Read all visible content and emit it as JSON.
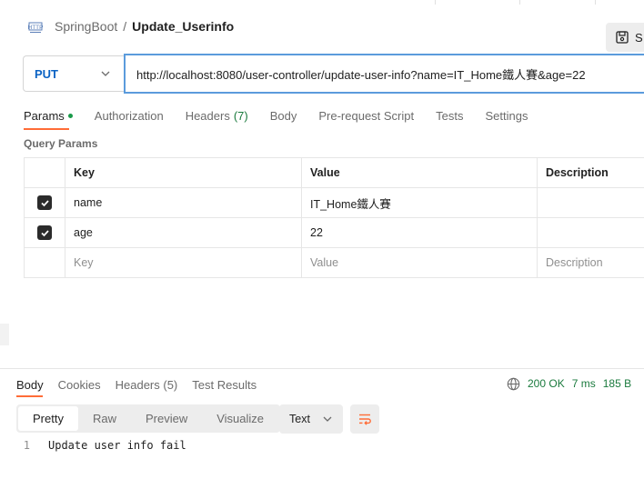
{
  "breadcrumb": {
    "collection": "SpringBoot",
    "separator": "/",
    "request_name": "Update_Userinfo"
  },
  "toolbar": {
    "save_label": "S"
  },
  "request": {
    "method": "PUT",
    "url": "http://localhost:8080/user-controller/update-user-info?name=IT_Home鐵人賽&age=22"
  },
  "request_tabs": [
    {
      "label": "Params",
      "active": true,
      "indicator": "green-dot"
    },
    {
      "label": "Authorization"
    },
    {
      "label": "Headers",
      "count": "(7)"
    },
    {
      "label": "Body"
    },
    {
      "label": "Pre-request Script"
    },
    {
      "label": "Tests"
    },
    {
      "label": "Settings"
    }
  ],
  "query_params": {
    "title": "Query Params",
    "columns": {
      "key": "Key",
      "value": "Value",
      "description": "Description"
    },
    "rows": [
      {
        "checked": true,
        "key": "name",
        "value": "IT_Home鐵人賽",
        "description": ""
      },
      {
        "checked": true,
        "key": "age",
        "value": "22",
        "description": ""
      }
    ],
    "placeholder": {
      "key": "Key",
      "value": "Value",
      "description": "Description"
    }
  },
  "response_tabs": [
    {
      "label": "Body",
      "active": true
    },
    {
      "label": "Cookies"
    },
    {
      "label": "Headers",
      "count": "(5)"
    },
    {
      "label": "Test Results"
    }
  ],
  "response_meta": {
    "status": "200 OK",
    "time": "7 ms",
    "size": "185 B"
  },
  "view_modes": [
    {
      "label": "Pretty",
      "active": true
    },
    {
      "label": "Raw"
    },
    {
      "label": "Preview"
    },
    {
      "label": "Visualize"
    }
  ],
  "format_select": {
    "value": "Text"
  },
  "response_body": [
    {
      "line": "1",
      "text": "Update user info fail"
    }
  ],
  "colors": {
    "accent": "#ff6c37",
    "method_put": "#0b63c4",
    "status_ok": "#1a7a3d",
    "url_focus": "#5b9bdc"
  },
  "icons": {
    "request_type": "http-icon",
    "save": "save-icon",
    "globe": "globe-icon",
    "wrap": "wrap-lines-icon"
  }
}
